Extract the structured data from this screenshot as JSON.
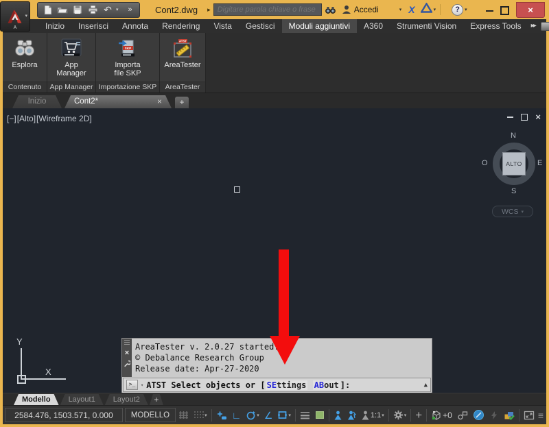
{
  "titlebar": {
    "document_title": "Cont2.dwg",
    "search_placeholder": "Digitare parola chiave o frase",
    "signin_label": "Accedi"
  },
  "ribbon": {
    "tabs": [
      {
        "label": "Inizio"
      },
      {
        "label": "Inserisci"
      },
      {
        "label": "Annota"
      },
      {
        "label": "Rendering"
      },
      {
        "label": "Vista"
      },
      {
        "label": "Gestisci"
      },
      {
        "label": "Moduli aggiuntivi"
      },
      {
        "label": "A360"
      },
      {
        "label": "Strumenti Vision"
      },
      {
        "label": "Express Tools"
      }
    ],
    "active_tab": "Moduli aggiuntivi",
    "panels": [
      {
        "title": "Contenuto",
        "button_label": "Esplora"
      },
      {
        "title": "App Manager",
        "button_label": "App Manager"
      },
      {
        "title": "Importazione SKP",
        "button_label": "Importa file SKP"
      },
      {
        "title": "AreaTester",
        "button_label": "AreaTester"
      }
    ]
  },
  "file_tabs": {
    "tab1": "Inizio",
    "tab2": "Cont2*"
  },
  "viewport": {
    "control_minus": "[−]",
    "control_view": "[Alto]",
    "control_visual": "[Wireframe 2D]",
    "viewcube": {
      "n": "N",
      "s": "S",
      "e": "E",
      "w": "O",
      "center": "ALTO"
    },
    "wcs_label": "WCS"
  },
  "command": {
    "history": [
      "AreaTester v. 2.0.27 started...",
      "© Debalance Research Group",
      "Release date: Apr-27-2020"
    ],
    "prompt_text": "ATST Select objects or [",
    "keywords": [
      {
        "hi": "SE",
        "rest": "ttings"
      },
      {
        "hi": "AB",
        "rest": "out"
      }
    ],
    "prompt_close": "]:"
  },
  "layout_tabs": {
    "model": "Modello",
    "layout1": "Layout1",
    "layout2": "Layout2",
    "add": "+"
  },
  "statusbar": {
    "coordinates": "2584.476, 1503.571, 0.000",
    "space_label": "MODELLO",
    "annotation_scale": "1:1",
    "viewport_value": "+0"
  },
  "glyphs": {
    "chevron": "▾",
    "more": "»",
    "undo": "↶",
    "play": "▸",
    "close": "×",
    "up": "▲",
    "ortho": "∟",
    "angle": "∠",
    "lines": "≡",
    "question": "?",
    "exchange": "X",
    "prompt_icon": ">_",
    "plus": "+",
    "mini_a": "A"
  },
  "colors": {
    "frame_orange": "#eab64f",
    "accent_blue": "#45a1e6",
    "close_red": "#c75050",
    "arrow_red": "#f30d0d",
    "canvas_dark": "#20252d"
  }
}
